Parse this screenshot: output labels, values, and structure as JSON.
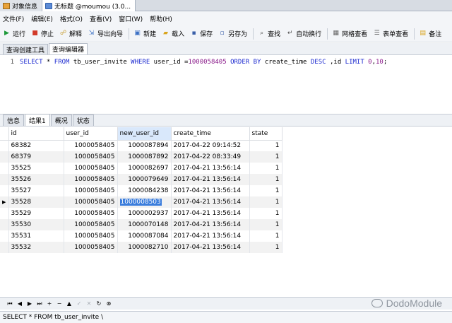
{
  "tabs": [
    {
      "label": "对象信息",
      "icon": "table-icon"
    },
    {
      "label": "无标题 @moumou (3.0...",
      "icon": "query-icon"
    }
  ],
  "menu": [
    "文件(F)",
    "编辑(E)",
    "格式(O)",
    "查看(V)",
    "窗口(W)",
    "帮助(H)"
  ],
  "toolbar": {
    "run": "运行",
    "stop": "停止",
    "explain": "解释",
    "export": "导出向导",
    "new": "新建",
    "load": "载入",
    "save": "保存",
    "save_as": "另存为",
    "find": "查找",
    "wrap": "自动换行",
    "grid_view": "网格查看",
    "form_view": "表单查看",
    "note": "备注"
  },
  "subtabs": [
    "查询创建工具",
    "查询编辑器"
  ],
  "editor": {
    "line_no": "1",
    "sql": {
      "kw1": "SELECT",
      "t1": " * ",
      "kw2": "FROM",
      "t2": " tb_user_invite ",
      "kw3": "WHERE",
      "t3": " user_id =",
      "n1": "1000058405",
      "t4": " ",
      "kw4": "ORDER BY",
      "t5": " create_time ",
      "kw5": "DESC",
      "t6": " ,id ",
      "kw6": "LIMIT",
      "t7": " ",
      "n2": "0",
      "t8": ",",
      "n3": "10",
      "t9": ";"
    }
  },
  "result_tabs": [
    "信息",
    "结果1",
    "概况",
    "状态"
  ],
  "grid": {
    "columns": [
      "id",
      "user_id",
      "new_user_id",
      "create_time",
      "state"
    ],
    "rows": [
      [
        "68382",
        "1000058405",
        "1000087894",
        "2017-04-22 09:14:52",
        "1"
      ],
      [
        "68379",
        "1000058405",
        "1000087892",
        "2017-04-22 08:33:49",
        "1"
      ],
      [
        "35525",
        "1000058405",
        "1000082697",
        "2017-04-21 13:56:14",
        "1"
      ],
      [
        "35526",
        "1000058405",
        "1000079649",
        "2017-04-21 13:56:14",
        "1"
      ],
      [
        "35527",
        "1000058405",
        "1000084238",
        "2017-04-21 13:56:14",
        "1"
      ],
      [
        "35528",
        "1000058405",
        "1000008503",
        "2017-04-21 13:56:14",
        "1"
      ],
      [
        "35529",
        "1000058405",
        "1000002937",
        "2017-04-21 13:56:14",
        "1"
      ],
      [
        "35530",
        "1000058405",
        "1000070148",
        "2017-04-21 13:56:14",
        "1"
      ],
      [
        "35531",
        "1000058405",
        "1000087084",
        "2017-04-21 13:56:14",
        "1"
      ],
      [
        "35532",
        "1000058405",
        "1000082710",
        "2017-04-21 13:56:14",
        "1"
      ]
    ],
    "selected_row": 5,
    "selected_col": 2
  },
  "watermark": "DodoModule",
  "status": "SELECT * FROM tb_user_invite \\"
}
